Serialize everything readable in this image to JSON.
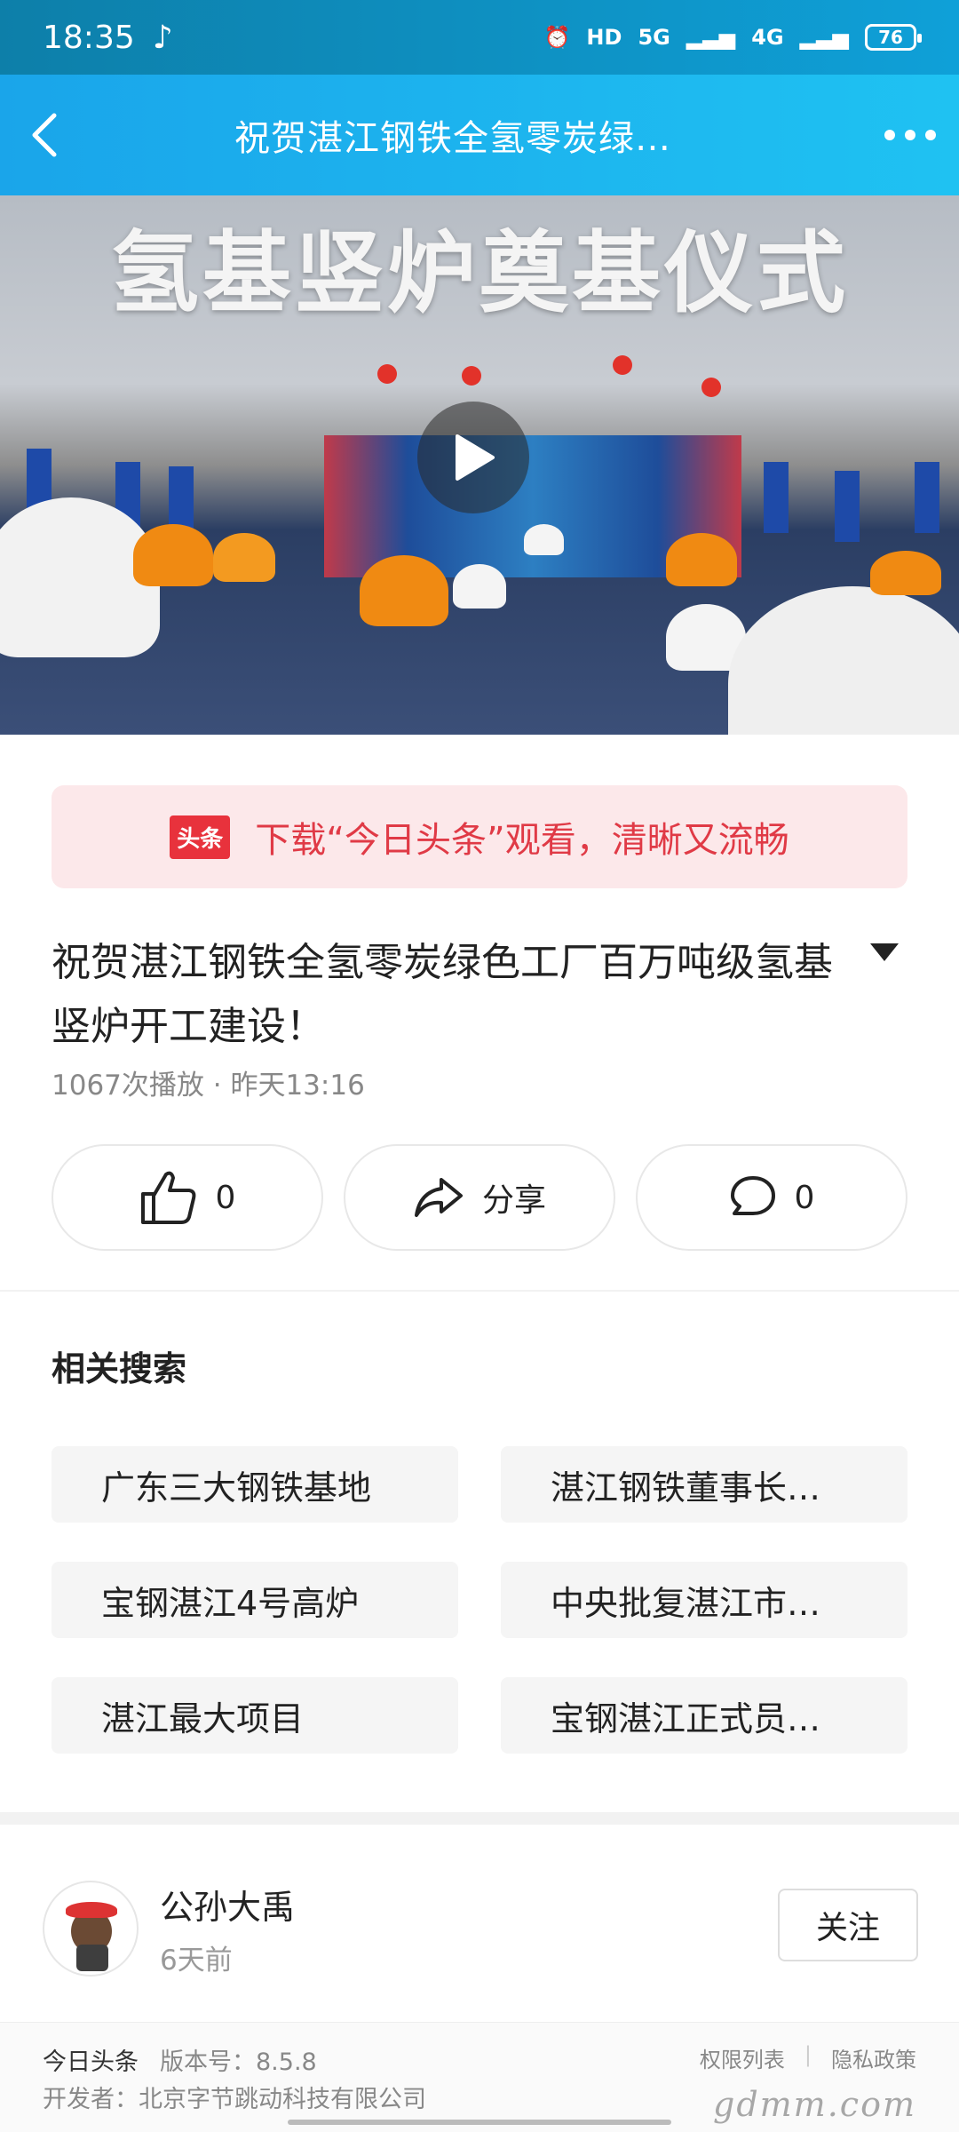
{
  "status_bar": {
    "time": "18:35",
    "battery": "76",
    "net1": "5G",
    "net2": "4G",
    "hd": "HD"
  },
  "nav": {
    "title": "祝贺湛江钢铁全氢零炭绿…"
  },
  "video": {
    "caption": "氢基竖炉奠基仪式"
  },
  "banner": {
    "logo": "头条",
    "text": "下载“今日头条”观看，清晰又流畅"
  },
  "article": {
    "title": "祝贺湛江钢铁全氢零炭绿色工厂百万吨级氢基竖炉开工建设！",
    "meta": "1067次播放 · 昨天13:16"
  },
  "actions": {
    "like_count": "0",
    "share_label": "分享",
    "comment_count": "0"
  },
  "related": {
    "title": "相关搜索",
    "items": [
      "广东三大钢铁基地",
      "湛江钢铁董事长…",
      "宝钢湛江4号高炉",
      "中央批复湛江市…",
      "湛江最大项目",
      "宝钢湛江正式员…"
    ]
  },
  "author": {
    "name": "公孙大禹",
    "time": "6天前",
    "follow_label": "关注"
  },
  "footer": {
    "app": "今日头条",
    "version": "版本号：8.5.8",
    "developer": "开发者：北京字节跳动科技有限公司",
    "permissions": "权限列表",
    "privacy": "隐私政策",
    "watermark": "gdmm.com"
  }
}
